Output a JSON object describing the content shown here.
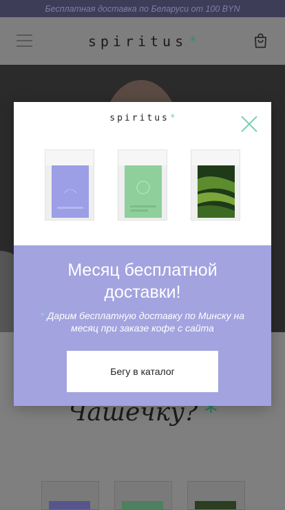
{
  "promo_bar": {
    "text": "Бесплатная доставка по Беларуси от 100 BYN"
  },
  "header": {
    "logo_text": "spiritus",
    "logo_star": "*",
    "icons": [
      "menu-icon",
      "cart-icon"
    ]
  },
  "page": {
    "headline": "Чашечку?",
    "headline_star": "*"
  },
  "modal": {
    "logo_text": "spiritus",
    "logo_star": "*",
    "title": "Месяц бесплатной доставки!",
    "subtitle_star": "*",
    "subtitle": "Дарим бесплатную доставку по Минску на месяц при заказе кофе с сайта",
    "cta_label": "Бегу в каталог",
    "close_icon": "close-icon"
  },
  "colors": {
    "accent_green": "#7dd0b2",
    "modal_purple": "#a3a3e0",
    "promo_bar": "#3e3d58"
  }
}
